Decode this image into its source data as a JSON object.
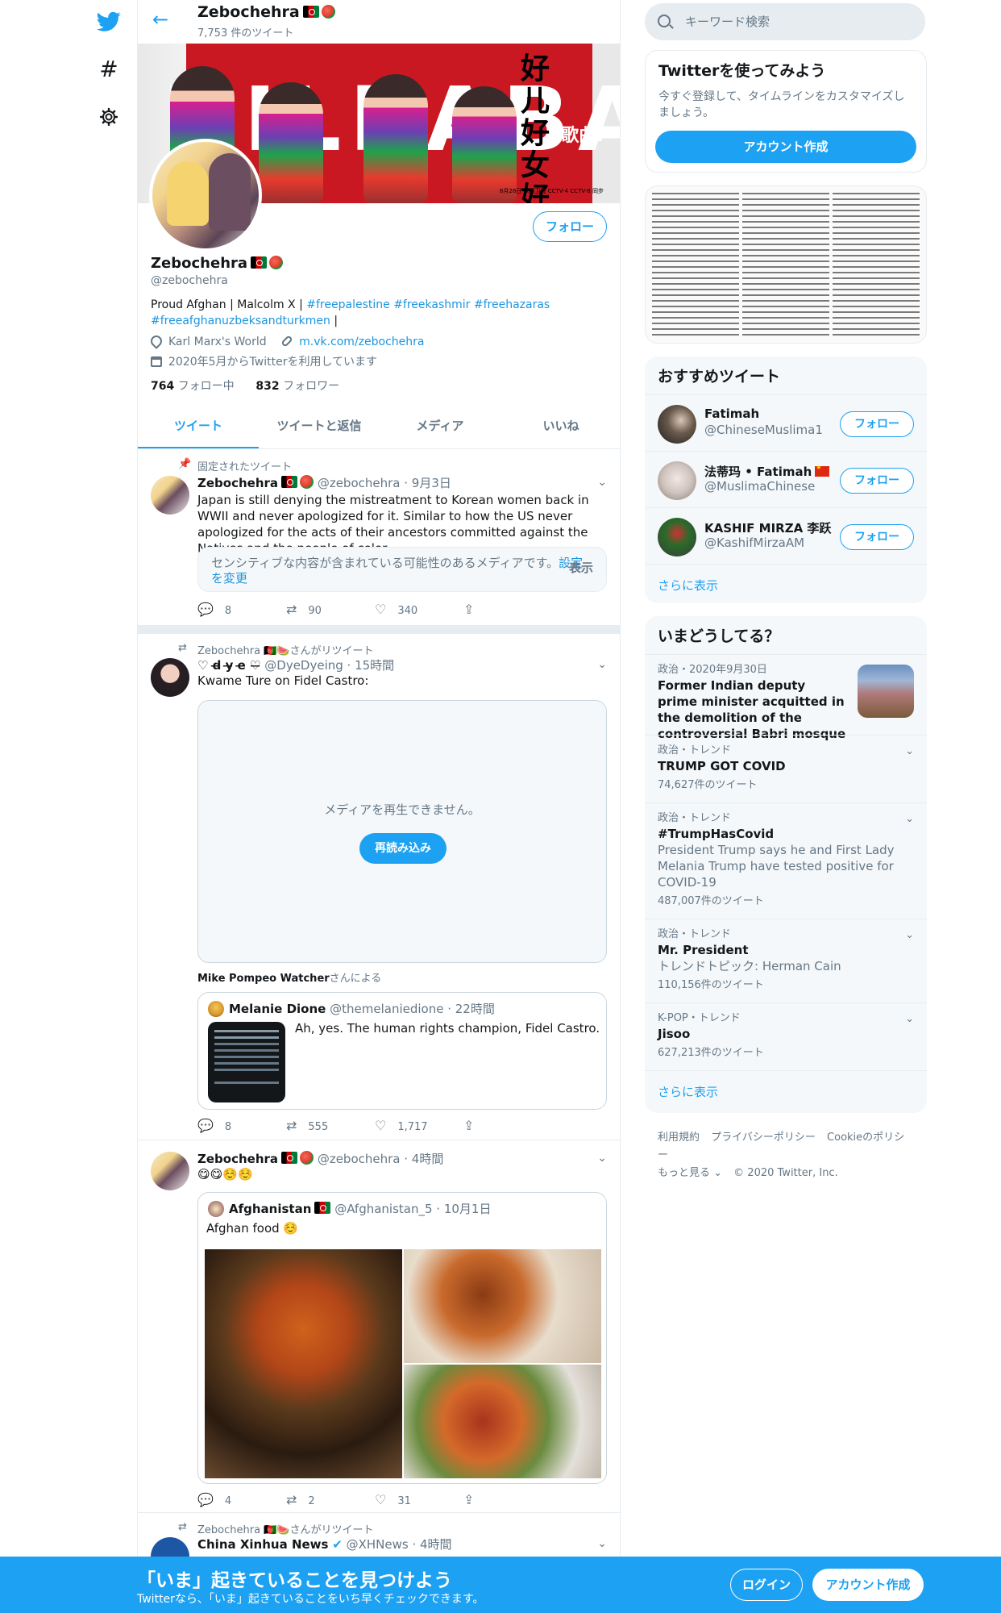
{
  "header": {
    "name": "Zebochehra",
    "tweet_count": "7,753 件のツイート"
  },
  "banner": {
    "big_text": "DILRABA",
    "zh_title": "好儿好女好家园",
    "song_label": "歌曲:",
    "small_text": "8月28日 陕西卫视 CCTV-4 CCTV-8 同步"
  },
  "profile": {
    "name": "Zebochehra",
    "handle": "@zebochehra",
    "bio_prefix": "Proud Afghan | Malcolm X | ",
    "bio_tags": [
      "#freepalestine",
      "#freekashmir",
      "#freehazaras",
      "#freeafghanuzbeksandturkmen"
    ],
    "bio_suffix": " |",
    "location": "Karl Marx's World",
    "link": "m.vk.com/zebochehra",
    "joined": "2020年5月からTwitterを利用しています",
    "following_count": "764",
    "following_label": "フォロー中",
    "followers_count": "832",
    "followers_label": "フォロワー",
    "follow_button": "フォロー"
  },
  "tabs": [
    "ツイート",
    "ツイートと返信",
    "メディア",
    "いいね"
  ],
  "tweets": [
    {
      "context": "固定されたツイート",
      "name": "Zebochehra",
      "handle": "@zebochehra",
      "time": "9月3日",
      "text": "Japan is still denying the mistreatment to Korean women back in WWII and never apologized for it. Similar to how the US never apologized for the acts of their ancestors committed against the Natives and the people of color.",
      "sensitive_text": "センシティブな内容が含まれている可能性のあるメディアです。",
      "sensitive_link": "設定を変更",
      "sensitive_show": "表示",
      "replies": "8",
      "retweets": "90",
      "likes": "340"
    },
    {
      "context": "Zebochehra 🇦🇫🍉さんがリツイート",
      "name": "♡ d̶ y̶ e̶ ♡̶",
      "handle": "@DyeDyeing",
      "time": "15時間",
      "text": "Kwame Ture on Fidel Castro:",
      "media_error": "メディアを再生できません。",
      "reload": "再読み込み",
      "attribution_name": "Mike Pompeo Watcher",
      "attribution_suffix": "さんによる",
      "quote": {
        "name": "Melanie Dione",
        "handle": "@themelaniedione",
        "time": "22時間",
        "text": "Ah, yes. The human rights champion, Fidel Castro."
      },
      "replies": "8",
      "retweets": "555",
      "likes": "1,717"
    },
    {
      "name": "Zebochehra",
      "handle": "@zebochehra",
      "time": "4時間",
      "text": "😋😋☺️☺️",
      "quote": {
        "name": "Afghanistan",
        "handle": "@Afghanistan_5",
        "time": "10月1日",
        "text": "Afghan food ☺️"
      },
      "replies": "4",
      "retweets": "2",
      "likes": "31"
    },
    {
      "context": "Zebochehra 🇦🇫🍉さんがリツイート",
      "name": "China Xinhua News",
      "handle": "@XHNews",
      "time": "4時間"
    }
  ],
  "sidebar": {
    "search_placeholder": "キーワード検索",
    "signup": {
      "title": "Twitterを使ってみよう",
      "subtitle": "今すぐ登録して、タイムラインをカスタマイズしましょう。",
      "button": "アカウント作成"
    },
    "who_to_follow": {
      "title": "おすすめツイート",
      "users": [
        {
          "name": "Fatimah",
          "handle": "@ChineseMuslima1",
          "button": "フォロー"
        },
        {
          "name": "法蒂玛 • Fatimah",
          "handle": "@MuslimaChinese",
          "button": "フォロー"
        },
        {
          "name": "KASHIF MIRZA 李跃",
          "handle": "@KashifMirzaAM",
          "button": "フォロー"
        }
      ],
      "more": "さらに表示"
    },
    "trends": {
      "title": "いまどうしてる？",
      "items": [
        {
          "category": "政治・2020年9月30日",
          "title": "Former Indian deputy prime minister acquitted in the demolition of the controversial Babri mosque"
        },
        {
          "category": "政治・トレンド",
          "title": "TRUMP GOT COVID",
          "count": "74,627件のツイート"
        },
        {
          "category": "政治・トレンド",
          "title": "#TrumpHasCovid",
          "desc": "President Trump says he and First Lady Melania Trump have tested positive for COVID-19",
          "count": "487,007件のツイート"
        },
        {
          "category": "政治・トレンド",
          "title": "Mr. President",
          "desc": "トレンドトピック: Herman Cain",
          "count": "110,156件のツイート"
        },
        {
          "category": "K-POP・トレンド",
          "title": "Jisoo",
          "count": "627,213件のツイート"
        }
      ],
      "more": "さらに表示"
    },
    "footer": [
      "利用規約",
      "プライバシーポリシー",
      "Cookieのポリシー",
      "もっと見る ⌄",
      "© 2020 Twitter, Inc."
    ]
  },
  "bottom_bar": {
    "title": "「いま」起きていることを見つけよう",
    "subtitle": "Twitterなら、「いま」起きていることをいち早くチェックできます。",
    "login": "ログイン",
    "signup": "アカウント作成"
  },
  "colors": {
    "accent": "#1da1f2",
    "text": "#14171a",
    "muted": "#657786",
    "border": "#e6ecf0"
  }
}
